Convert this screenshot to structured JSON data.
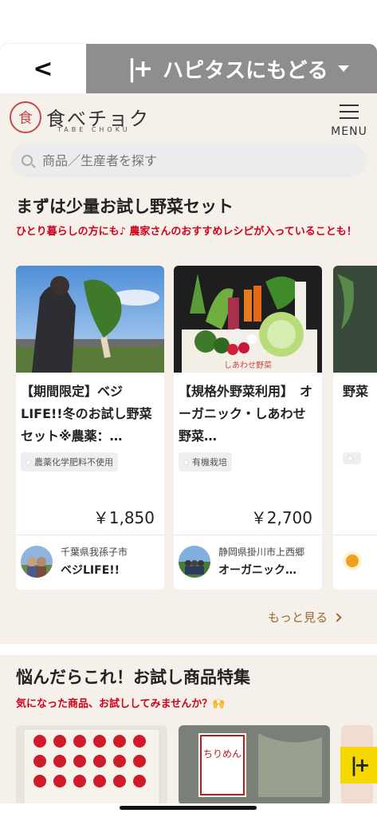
{
  "nav": {
    "back_glyph": "<",
    "hapitas_logo": "|+",
    "hapitas_label": "ハピタスにもどる"
  },
  "header": {
    "logo_glyph": "食",
    "logo_text": "食べチョク",
    "logo_sub": "TABE CHOKU",
    "menu_label": "MENU"
  },
  "search": {
    "placeholder": "商品／生産者を探す"
  },
  "section1": {
    "title": "まずは少量お試し野菜セット",
    "subtitle": "ひとり暮らしの方にも♪ 農家さんのおすすめレシピが入っていることも！",
    "more_label": "もっと見る",
    "cards": [
      {
        "title": "【期間限定】ベジLIFE!!冬のお試し野菜セット※農薬：…",
        "tag": "農薬化学肥料不使用",
        "price": "￥1,850",
        "location": "千葉県我孫子市",
        "producer": "ベジLIFE!!"
      },
      {
        "title": "【規格外野菜利用】　オーガニック・しあわせ野菜…",
        "tag": "有機栽培",
        "price": "￥2,700",
        "location": "静岡県掛川市上西郷",
        "producer": "オーガニック…"
      },
      {
        "title": "野菜",
        "tag": "",
        "price": "",
        "location": "",
        "producer": ""
      }
    ]
  },
  "section2": {
    "title": "悩んだらこれ！お試し商品特集",
    "subtitle": "気になった商品、お試ししてみませんか？🙌"
  },
  "float_button": {
    "label": "|+"
  },
  "colors": {
    "background": "#f5f1ea",
    "accent_red": "#d0021b",
    "link_brown": "#9a6a2f",
    "hapitas_gray": "#8e8e8e",
    "hapitas_yellow": "#f5d800"
  }
}
